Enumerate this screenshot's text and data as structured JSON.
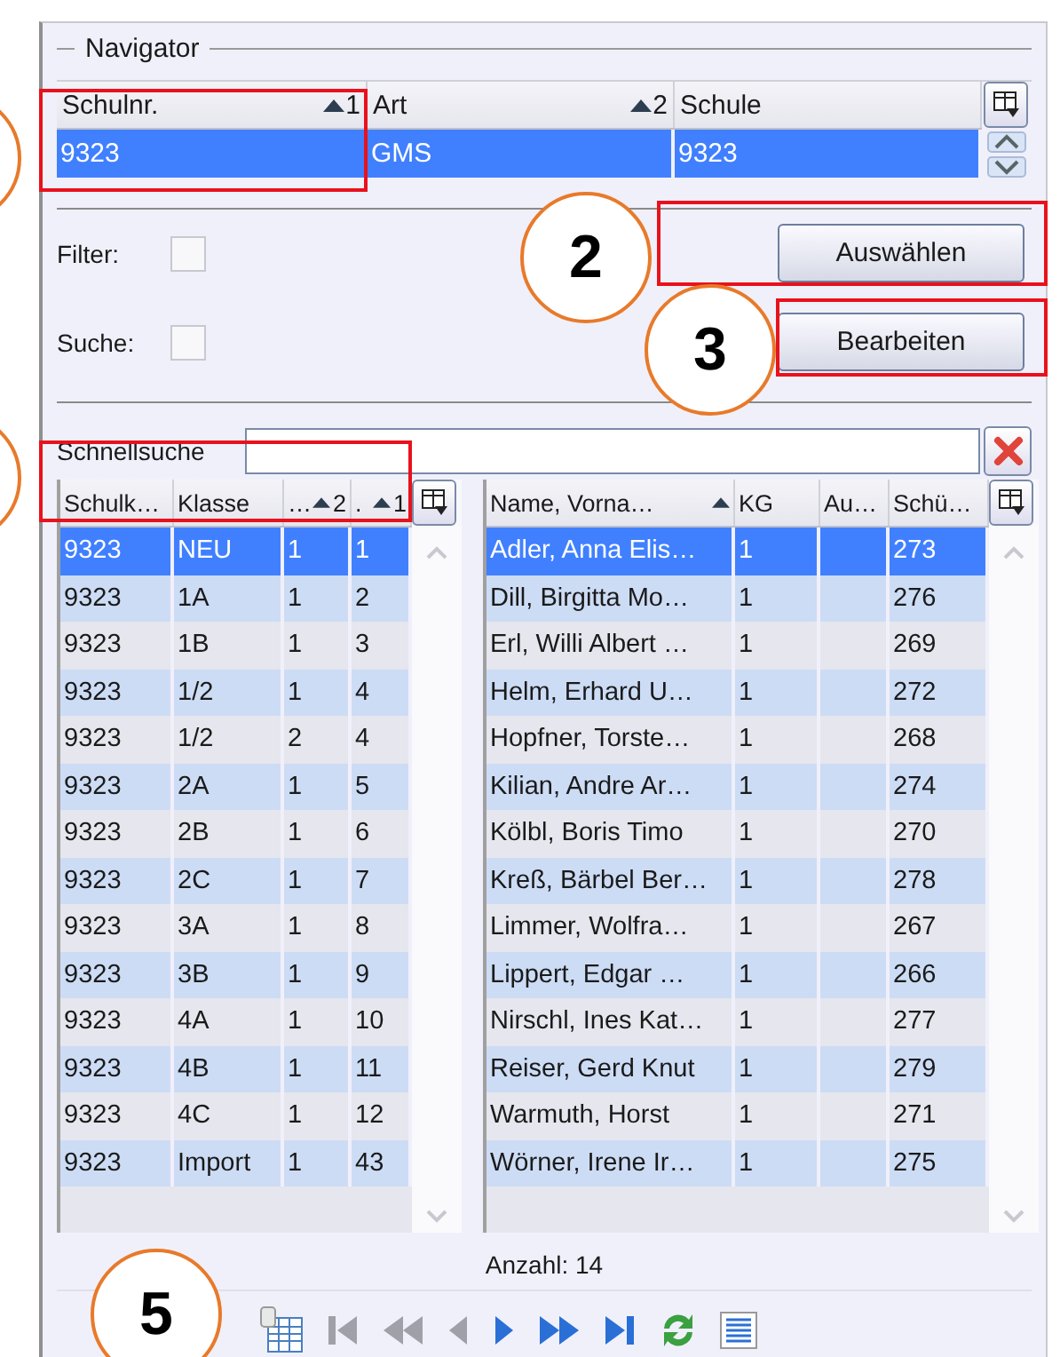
{
  "navigator": {
    "title": "Navigator",
    "columns": [
      {
        "label": "Schulnr.",
        "sort_rank": "1"
      },
      {
        "label": "Art",
        "sort_rank": "2"
      },
      {
        "label": "Schule"
      }
    ],
    "rows": [
      {
        "cells": [
          "9323",
          "GMS",
          "9323"
        ],
        "selected": true
      }
    ]
  },
  "filters": [
    {
      "label": "Filter:",
      "checked": false
    },
    {
      "label": "Suche:",
      "checked": false
    }
  ],
  "buttons": [
    "Auswählen",
    "Bearbeiten"
  ],
  "quick_search": {
    "label": "Schnellsuche"
  },
  "classes_table": {
    "columns": [
      {
        "label": "Schulk…"
      },
      {
        "label": "Klasse"
      },
      {
        "label": "…",
        "sort_rank": "2"
      },
      {
        "label": ".",
        "sort_rank": "1"
      }
    ],
    "rows": [
      {
        "cells": [
          "9323",
          "NEU",
          "1",
          "1"
        ],
        "selected": true
      },
      {
        "cells": [
          "9323",
          "1A",
          "1",
          "2"
        ],
        "selected": false
      },
      {
        "cells": [
          "9323",
          "1B",
          "1",
          "3"
        ],
        "selected": false
      },
      {
        "cells": [
          "9323",
          "1/2",
          "1",
          "4"
        ],
        "selected": false
      },
      {
        "cells": [
          "9323",
          "1/2",
          "2",
          "4"
        ],
        "selected": false
      },
      {
        "cells": [
          "9323",
          "2A",
          "1",
          "5"
        ],
        "selected": false
      },
      {
        "cells": [
          "9323",
          "2B",
          "1",
          "6"
        ],
        "selected": false
      },
      {
        "cells": [
          "9323",
          "2C",
          "1",
          "7"
        ],
        "selected": false
      },
      {
        "cells": [
          "9323",
          "3A",
          "1",
          "8"
        ],
        "selected": false
      },
      {
        "cells": [
          "9323",
          "3B",
          "1",
          "9"
        ],
        "selected": false
      },
      {
        "cells": [
          "9323",
          "4A",
          "1",
          "10"
        ],
        "selected": false
      },
      {
        "cells": [
          "9323",
          "4B",
          "1",
          "11"
        ],
        "selected": false
      },
      {
        "cells": [
          "9323",
          "4C",
          "1",
          "12"
        ],
        "selected": false
      },
      {
        "cells": [
          "9323",
          "Import",
          "1",
          "43"
        ],
        "selected": false
      }
    ]
  },
  "students_table": {
    "columns": [
      {
        "label": "Name, Vorna…",
        "sorted": true
      },
      {
        "label": "KG"
      },
      {
        "label": "Au…"
      },
      {
        "label": "Schü…"
      }
    ],
    "rows": [
      {
        "cells": [
          "Adler, Anna Elis…",
          "1",
          "",
          "273"
        ],
        "selected": true
      },
      {
        "cells": [
          "Dill, Birgitta Mo…",
          "1",
          "",
          "276"
        ],
        "selected": false
      },
      {
        "cells": [
          "Erl, Willi Albert …",
          "1",
          "",
          "269"
        ],
        "selected": false
      },
      {
        "cells": [
          "Helm, Erhard U…",
          "1",
          "",
          "272"
        ],
        "selected": false
      },
      {
        "cells": [
          "Hopfner, Torste…",
          "1",
          "",
          "268"
        ],
        "selected": false
      },
      {
        "cells": [
          "Kilian, Andre Ar…",
          "1",
          "",
          "274"
        ],
        "selected": false
      },
      {
        "cells": [
          "Kölbl, Boris Timo",
          "1",
          "",
          "270"
        ],
        "selected": false
      },
      {
        "cells": [
          "Kreß, Bärbel Ber…",
          "1",
          "",
          "278"
        ],
        "selected": false
      },
      {
        "cells": [
          "Limmer, Wolfra…",
          "1",
          "",
          "267"
        ],
        "selected": false
      },
      {
        "cells": [
          "Lippert, Edgar …",
          "1",
          "",
          "266"
        ],
        "selected": false
      },
      {
        "cells": [
          "Nirschl, Ines Kat…",
          "1",
          "",
          "277"
        ],
        "selected": false
      },
      {
        "cells": [
          "Reiser, Gerd Knut",
          "1",
          "",
          "279"
        ],
        "selected": false
      },
      {
        "cells": [
          "Warmuth, Horst",
          "1",
          "",
          "271"
        ],
        "selected": false
      },
      {
        "cells": [
          "Wörner, Irene Ir…",
          "1",
          "",
          "275"
        ],
        "selected": false
      }
    ]
  },
  "count": "Anzahl: 14",
  "toolbar": [
    {
      "kind": "columns",
      "disabled": false
    },
    {
      "kind": "first",
      "disabled": true
    },
    {
      "kind": "page-back",
      "disabled": true
    },
    {
      "kind": "back",
      "disabled": true
    },
    {
      "kind": "forward",
      "disabled": false
    },
    {
      "kind": "page-forward",
      "disabled": false
    },
    {
      "kind": "last",
      "disabled": false
    },
    {
      "kind": "refresh",
      "disabled": false
    },
    {
      "kind": "list",
      "disabled": false
    }
  ],
  "callouts": [
    {
      "kind": "partial"
    },
    {
      "kind": "partial"
    },
    {
      "kind": "full",
      "label": "2"
    },
    {
      "kind": "full",
      "label": "3"
    },
    {
      "kind": "full",
      "label": "5"
    }
  ]
}
